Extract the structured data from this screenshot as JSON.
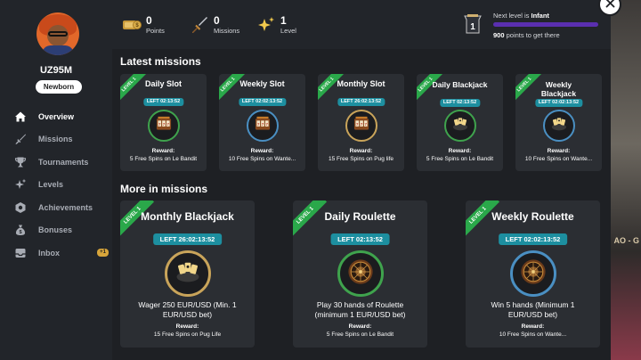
{
  "backdrop": {
    "peek_text": "AO - G"
  },
  "profile": {
    "username": "UZ95M",
    "rank": "Newborn"
  },
  "nav": [
    {
      "label": "Overview",
      "icon": "home-icon",
      "active": true
    },
    {
      "label": "Missions",
      "icon": "sword-icon"
    },
    {
      "label": "Tournaments",
      "icon": "trophy-icon"
    },
    {
      "label": "Levels",
      "icon": "sparkle-icon"
    },
    {
      "label": "Achievements",
      "icon": "medal-icon"
    },
    {
      "label": "Bonuses",
      "icon": "moneybag-icon"
    },
    {
      "label": "Inbox",
      "icon": "inbox-icon",
      "count": "+1"
    }
  ],
  "stats": {
    "points": {
      "value": "0",
      "label": "Points",
      "icon": "coins-icon"
    },
    "missions": {
      "value": "0",
      "label": "Missions",
      "icon": "sword-icon"
    },
    "level": {
      "value": "1",
      "label": "Level",
      "icon": "sparkle-icon"
    }
  },
  "level_progress": {
    "next_prefix": "Next level is ",
    "next_name": "Infant",
    "points_value": "900",
    "points_suffix": " points to get there",
    "progress": 0,
    "level_badge": "1"
  },
  "sections": {
    "latest_title": "Latest missions",
    "more_title": "More in missions"
  },
  "ribbon_label": "LEVEL 1",
  "reward_label": "Reward:",
  "latest_missions": [
    {
      "title": "Daily Slot",
      "left": "LEFT 02:13:52",
      "reward": "5 Free Spins on Le Bandit",
      "ring": "#3fa34d",
      "icon": "slot-machine-icon"
    },
    {
      "title": "Weekly Slot",
      "left": "LEFT 02:02:13:52",
      "reward": "10 Free Spins on Wante...",
      "ring": "#4a8fc2",
      "icon": "slot-machine-icon"
    },
    {
      "title": "Monthly Slot",
      "left": "LEFT 26:02:13:52",
      "reward": "15 Free Spins on Pug life",
      "ring": "#c9a45a",
      "icon": "slot-machine-icon"
    },
    {
      "title": "Daily Blackjack",
      "left": "LEFT 02:13:52",
      "reward": "5 Free Spins on Le Bandit",
      "ring": "#3fa34d",
      "icon": "cards-icon"
    },
    {
      "title": "Weekly Blackjack",
      "left": "LEFT 02:02:13:52",
      "reward": "10 Free Spins on Wante...",
      "ring": "#4a8fc2",
      "icon": "cards-icon"
    }
  ],
  "more_missions": [
    {
      "title": "Monthly Blackjack",
      "left": "LEFT 26:02:13:52",
      "description": "Wager 250 EUR/USD (Min. 1 EUR/USD bet)",
      "reward": "15 Free Spins on Pug Life",
      "ring": "#c9a45a",
      "icon": "cards-icon"
    },
    {
      "title": "Daily Roulette",
      "left": "LEFT 02:13:52",
      "description": "Play 30 hands of Roulette (minimum 1 EUR/USD bet)",
      "reward": "5 Free Spins on Le Bandit",
      "ring": "#3fa34d",
      "icon": "roulette-icon"
    },
    {
      "title": "Weekly Roulette",
      "left": "LEFT 02:02:13:52",
      "description": "Win 5 hands (Minimum 1 EUR/USD bet)",
      "reward": "10 Free Spins on Wante...",
      "ring": "#4a8fc2",
      "icon": "roulette-icon"
    }
  ],
  "colors": {
    "accent_teal": "#1d8fa0",
    "ribbon_green": "#2aa84a",
    "progress_purple": "#5a2fb0",
    "inbox_badge": "#d7a53b"
  }
}
